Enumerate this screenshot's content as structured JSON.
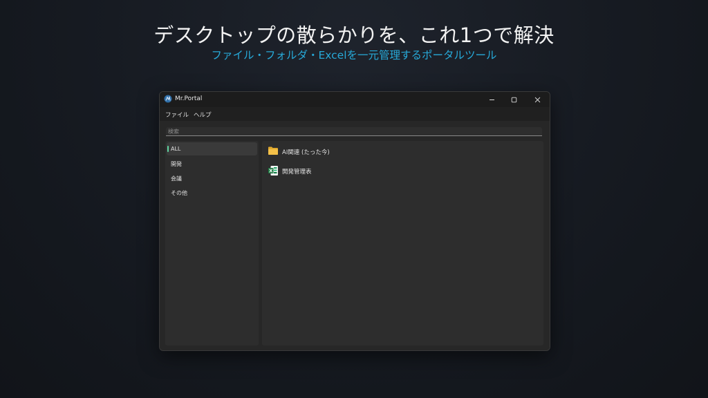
{
  "hero": {
    "title": "デスクトップの散らかりを、これ1つで解決",
    "subtitle": "ファイル・フォルダ・Excelを一元管理するポータルツール"
  },
  "window": {
    "title": "Mr.Portal",
    "controls": {
      "minimize": "minimize-icon",
      "maximize": "maximize-icon",
      "close": "close-icon"
    }
  },
  "menu": {
    "file": "ファイル",
    "help": "ヘルプ"
  },
  "search": {
    "placeholder": "検索",
    "value": ""
  },
  "categories": [
    {
      "label": "ALL",
      "selected": true
    },
    {
      "label": "開発",
      "selected": false
    },
    {
      "label": "会議",
      "selected": false
    },
    {
      "label": "その他",
      "selected": false
    }
  ],
  "items": [
    {
      "label": "AI関連 (たった今)",
      "icon": "folder-icon"
    },
    {
      "label": "開発管理表",
      "icon": "excel-icon"
    }
  ],
  "colors": {
    "accent_indicator": "#5fd4a0",
    "subtitle": "#27a9d8",
    "folder": "#f4c048",
    "excel": "#1f7a43"
  }
}
